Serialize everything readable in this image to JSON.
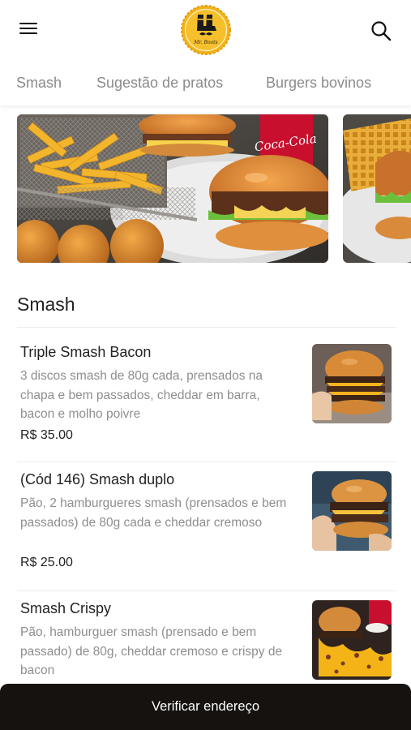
{
  "header": {
    "menu_icon": "hamburger-menu-icon",
    "logo_text": "Mr. Boots",
    "search_icon": "search-icon"
  },
  "tabs": [
    {
      "label": "Smash"
    },
    {
      "label": "Sugestão de pratos"
    },
    {
      "label": "Burgers bovinos"
    }
  ],
  "banners": [
    {
      "image": "fries-burger-coke-photo",
      "brand_text": "Coca-Cola"
    },
    {
      "image": "waffle-fries-burger-photo"
    }
  ],
  "section": {
    "title": "Smash",
    "items": [
      {
        "name": "Triple Smash Bacon",
        "description": "3 discos smash de 80g cada, prensados na chapa e bem passados, cheddar em barra, bacon e molho poivre",
        "price": "R$ 35.00",
        "image": "triple-smash-burger-photo"
      },
      {
        "name": "(Cód 146) Smash duplo",
        "description": "Pão, 2 hamburgueres smash (prensados e bem passados) de 80g cada e cheddar cremoso",
        "price": "R$ 25.00",
        "image": "double-smash-burger-photo"
      },
      {
        "name": "Smash Crispy",
        "description": "Pão, hamburguer smash (prensado e bem passado) de 80g, cheddar cremoso e crispy de bacon",
        "image": "crispy-smash-burger-photo"
      }
    ]
  },
  "bottom_bar": {
    "label": "Verificar endereço"
  },
  "colors": {
    "logo_yellow": "#f2b21b",
    "bottom_bar": "#15120f",
    "muted_text": "#8e8e8e",
    "tab_text": "#8b8b8b"
  }
}
